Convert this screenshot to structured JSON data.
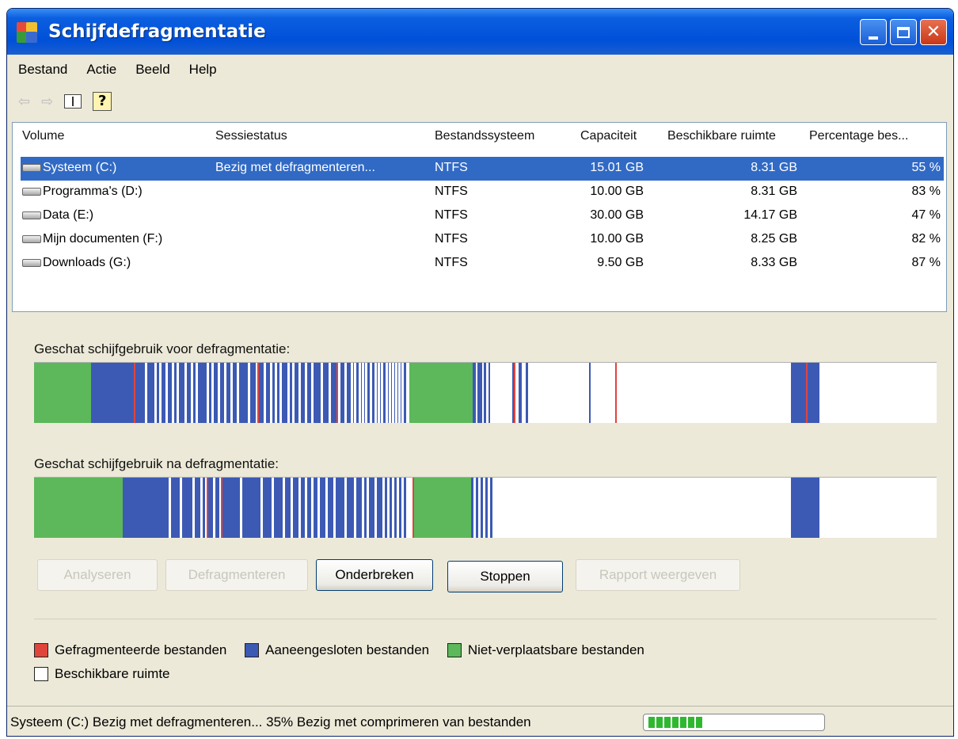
{
  "window": {
    "title": "Schijfdefragmentatie"
  },
  "menu": [
    "Bestand",
    "Actie",
    "Beeld",
    "Help"
  ],
  "columns": [
    "Volume",
    "Sessiestatus",
    "Bestandssysteem",
    "Capaciteit",
    "Beschikbare ruimte",
    "Percentage bes..."
  ],
  "volumes": [
    {
      "name": "Systeem (C:)",
      "status": "Bezig met defragmenteren...",
      "fs": "NTFS",
      "capacity": "15.01 GB",
      "free": "8.31 GB",
      "percent": "55 %"
    },
    {
      "name": "Programma's (D:)",
      "status": "",
      "fs": "NTFS",
      "capacity": "10.00 GB",
      "free": "8.31 GB",
      "percent": "83 %"
    },
    {
      "name": "Data (E:)",
      "status": "",
      "fs": "NTFS",
      "capacity": "30.00 GB",
      "free": "14.17 GB",
      "percent": "47 %"
    },
    {
      "name": "Mijn documenten (F:)",
      "status": "",
      "fs": "NTFS",
      "capacity": "10.00 GB",
      "free": "8.25 GB",
      "percent": "82 %"
    },
    {
      "name": "Downloads (G:)",
      "status": "",
      "fs": "NTFS",
      "capacity": "9.50 GB",
      "free": "8.33 GB",
      "percent": "87 %"
    }
  ],
  "before_label": "Geschat schijfgebruik voor defragmentatie:",
  "after_label": "Geschat schijfgebruik na defragmentatie:",
  "buttons": {
    "analyze": "Analyseren",
    "defrag": "Defragmenteren",
    "pause": "Onderbreken",
    "stop": "Stoppen",
    "report": "Rapport weergeven"
  },
  "legend": {
    "fragmented": "Gefragmenteerde bestanden",
    "contiguous": "Aaneengesloten bestanden",
    "unmovable": "Niet-verplaatsbare bestanden",
    "free": "Beschikbare ruimte"
  },
  "colors": {
    "fragmented": "#e0453c",
    "contiguous": "#3c5ab4",
    "unmovable": "#5cb85a",
    "free": "#ffffff"
  },
  "status": {
    "text": "Systeem (C:) Bezig met defragmenteren... 35%  Bezig met comprimeren van bestanden",
    "progress": 0.35
  }
}
